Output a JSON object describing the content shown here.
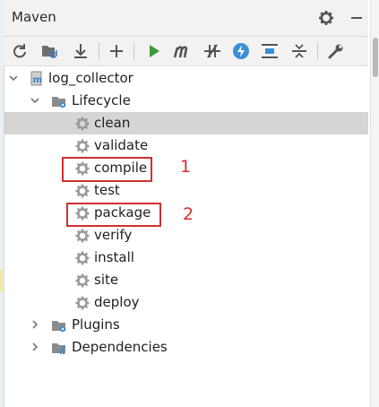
{
  "panel": {
    "title": "Maven"
  },
  "toolbar": {
    "items": [
      "reload-icon",
      "generate-sources-icon",
      "download-icon",
      "add-icon",
      "run-icon",
      "execute-goal-icon",
      "toggle-offline-icon",
      "skip-tests-icon",
      "show-dependencies-icon",
      "collapse-all-icon",
      "settings-wrench-icon"
    ]
  },
  "tree": {
    "project": "log_collector",
    "lifecycle": {
      "label": "Lifecycle",
      "goals": [
        "clean",
        "validate",
        "compile",
        "test",
        "package",
        "verify",
        "install",
        "site",
        "deploy"
      ],
      "selected": "clean"
    },
    "plugins": "Plugins",
    "dependencies": "Dependencies"
  },
  "annotations": {
    "first": "1",
    "second": "2"
  },
  "colors": {
    "accent_red": "#d32f2f",
    "run_green": "#3a9a3a",
    "selection": "#d5d5d5"
  }
}
